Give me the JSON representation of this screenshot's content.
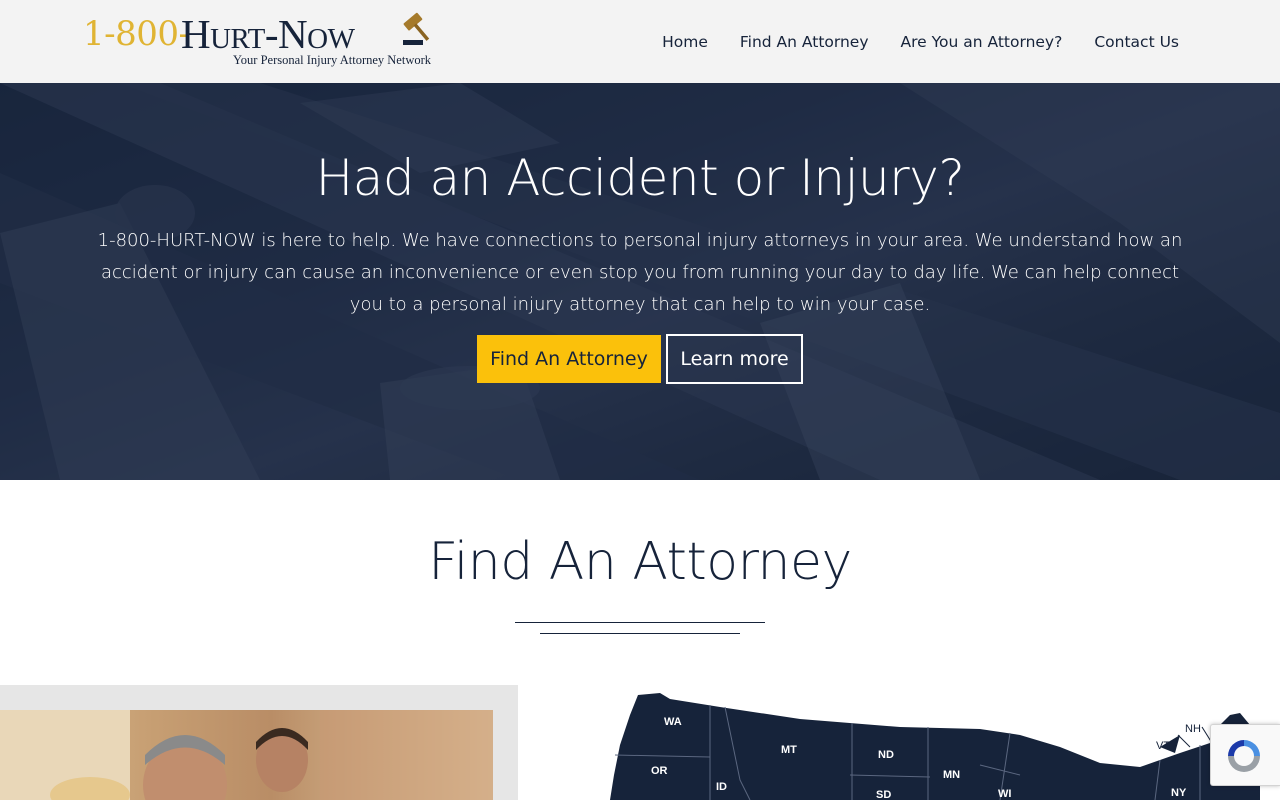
{
  "header": {
    "logo": {
      "number": "1-800-",
      "word": "Hurt-Now",
      "tagline": "Your Personal Injury Attorney Network",
      "icon": "gavel-icon"
    },
    "nav": [
      {
        "label": "Home"
      },
      {
        "label": "Find An Attorney"
      },
      {
        "label": "Are You an Attorney?"
      },
      {
        "label": "Contact Us"
      }
    ]
  },
  "hero": {
    "title": "Had an Accident or Injury?",
    "text": "1-800-HURT-NOW is here to help. We have connections to personal injury attorneys in your area. We understand how an accident or injury can cause an inconvenience or even stop you from running your day to day life. We can help connect you to a personal injury attorney that can help to win your case.",
    "primary_button": "Find An Attorney",
    "secondary_button": "Learn more"
  },
  "find_section": {
    "title": "Find An Attorney"
  },
  "map": {
    "states": [
      "WA",
      "OR",
      "ID",
      "MT",
      "ND",
      "SD",
      "MN",
      "WI",
      "VT",
      "NH",
      "NY"
    ]
  },
  "colors": {
    "navy": "#16233a",
    "gold": "#fbc10b",
    "logo_gold": "#e0b433",
    "header_bg": "#f3f3f3"
  },
  "recaptcha": {
    "icon": "recaptcha-icon"
  }
}
